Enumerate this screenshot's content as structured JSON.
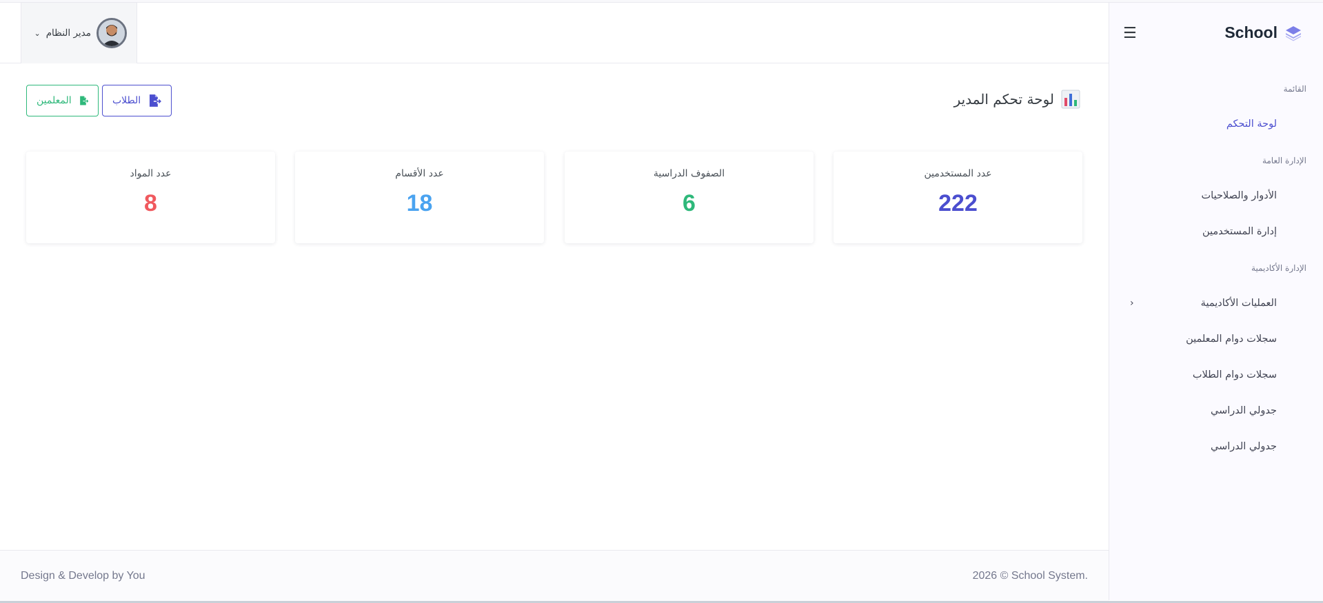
{
  "app": {
    "brand": "School",
    "colors": {
      "accent": "#4b4ecf",
      "success": "#2eb87a",
      "info": "#4aa3f0",
      "danger": "#f0595e"
    }
  },
  "sidebar": {
    "toggle_icon": "hamburger-icon",
    "sections": [
      {
        "title": "القائمة",
        "items": [
          {
            "label": "لوحة التحكم",
            "active": true
          }
        ]
      },
      {
        "title": "الإدارة العامة",
        "items": [
          {
            "label": "الأدوار والصلاحيات"
          },
          {
            "label": "إدارة المستخدمين"
          }
        ]
      },
      {
        "title": "الإدارة الأكاديمية",
        "items": [
          {
            "label": "العمليات الأكاديمية",
            "has_submenu": true
          },
          {
            "label": "سجلات دوام المعلمين"
          },
          {
            "label": "سجلات دوام الطلاب"
          },
          {
            "label": "جدولي الدراسي"
          },
          {
            "label": "جدولي الدراسي"
          }
        ]
      }
    ]
  },
  "header": {
    "user_name": "مدير النظام"
  },
  "page": {
    "title": "لوحة تحكم المدير",
    "buttons": {
      "students": "الطلاب",
      "teachers": "المعلمين"
    },
    "stats": [
      {
        "label": "عدد المستخدمين",
        "value": "222",
        "color": "#4b4ecf"
      },
      {
        "label": "الصفوف الدراسية",
        "value": "6",
        "color": "#2eb87a"
      },
      {
        "label": "عدد الأقسام",
        "value": "18",
        "color": "#4aa3f0"
      },
      {
        "label": "عدد المواد",
        "value": "8",
        "color": "#f0595e"
      }
    ]
  },
  "footer": {
    "left": "Design & Develop by You",
    "right": "2026 © School System."
  }
}
